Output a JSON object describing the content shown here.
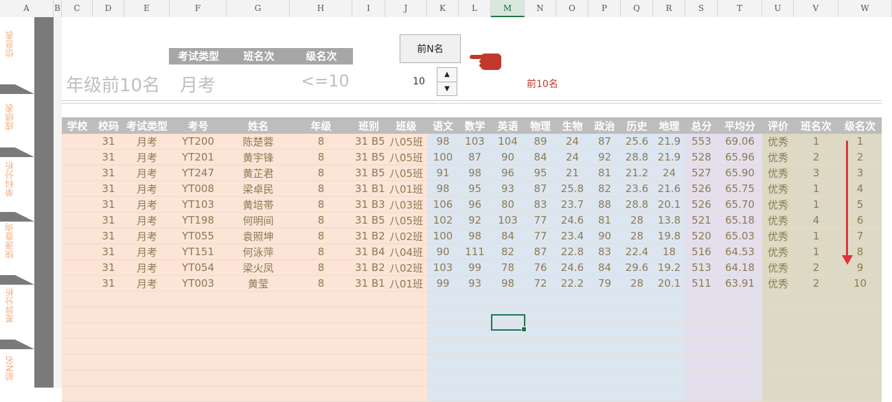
{
  "columns": [
    "A",
    "B",
    "C",
    "D",
    "E",
    "F",
    "G",
    "H",
    "I",
    "J",
    "K",
    "L",
    "M",
    "N",
    "O",
    "P",
    "Q",
    "R",
    "S",
    "T",
    "U",
    "V",
    "W"
  ],
  "sheet_tabs": [
    "信息表",
    "成绩表",
    "单科分析",
    "快速查询",
    "差异分析",
    "前N名"
  ],
  "title": "年级前10名",
  "criteria": {
    "headers": [
      "考试类型",
      "班名次",
      "级名次"
    ],
    "exam_type": "月考",
    "grade_rank_filter": "<=10"
  },
  "button_label": "前N名",
  "spinner_value": "10",
  "result_note": "前10名",
  "colors": {
    "accent": "#217346",
    "arrow": "#e0333a",
    "hand": "#c0392b"
  },
  "icons": [
    "pointing-hand-icon",
    "spin-up-icon",
    "spin-down-icon",
    "down-arrow-icon"
  ],
  "table": {
    "headers": [
      "学校",
      "校码",
      "考试类型",
      "考号",
      "姓名",
      "年级",
      "班别",
      "班级",
      "语文",
      "数学",
      "英语",
      "物理",
      "生物",
      "政治",
      "历史",
      "地理",
      "总分",
      "平均分",
      "评价",
      "班名次",
      "级名次"
    ],
    "rows": [
      [
        "",
        "31",
        "月考",
        "YT200",
        "陈楚蓉",
        "8",
        "31 B5",
        "八05班",
        "98",
        "103",
        "104",
        "89",
        "24",
        "87",
        "25.6",
        "21.9",
        "553",
        "69.06",
        "优秀",
        "1",
        "1"
      ],
      [
        "",
        "31",
        "月考",
        "YT201",
        "黄宇锋",
        "8",
        "31 B5",
        "八05班",
        "100",
        "87",
        "90",
        "84",
        "24",
        "92",
        "28.8",
        "21.9",
        "528",
        "65.96",
        "优秀",
        "2",
        "2"
      ],
      [
        "",
        "31",
        "月考",
        "YT247",
        "黄芷君",
        "8",
        "31 B5",
        "八05班",
        "91",
        "98",
        "96",
        "95",
        "21",
        "81",
        "21.2",
        "24",
        "527",
        "65.90",
        "优秀",
        "3",
        "3"
      ],
      [
        "",
        "31",
        "月考",
        "YT008",
        "梁卓民",
        "8",
        "31 B1",
        "八01班",
        "98",
        "95",
        "93",
        "87",
        "25.8",
        "82",
        "23.6",
        "21.6",
        "526",
        "65.75",
        "优秀",
        "1",
        "4"
      ],
      [
        "",
        "31",
        "月考",
        "YT103",
        "黄培帯",
        "8",
        "31 B3",
        "八03班",
        "106",
        "96",
        "80",
        "83",
        "23.7",
        "88",
        "28.8",
        "20.1",
        "526",
        "65.70",
        "优秀",
        "1",
        "5"
      ],
      [
        "",
        "31",
        "月考",
        "YT198",
        "何明间",
        "8",
        "31 B5",
        "八05班",
        "102",
        "92",
        "103",
        "77",
        "24.6",
        "81",
        "28",
        "13.8",
        "521",
        "65.18",
        "优秀",
        "4",
        "6"
      ],
      [
        "",
        "31",
        "月考",
        "YT055",
        "袁照坤",
        "8",
        "31 B2",
        "八02班",
        "100",
        "98",
        "84",
        "77",
        "23.4",
        "90",
        "28",
        "19.8",
        "520",
        "65.03",
        "优秀",
        "1",
        "7"
      ],
      [
        "",
        "31",
        "月考",
        "YT151",
        "何泳萍",
        "8",
        "31 B4",
        "八04班",
        "90",
        "111",
        "82",
        "87",
        "22.8",
        "83",
        "22.4",
        "18",
        "516",
        "64.53",
        "优秀",
        "1",
        "8"
      ],
      [
        "",
        "31",
        "月考",
        "YT054",
        "梁火凤",
        "8",
        "31 B2",
        "八02班",
        "103",
        "99",
        "78",
        "76",
        "24.6",
        "84",
        "29.6",
        "19.2",
        "513",
        "64.18",
        "优秀",
        "2",
        "9"
      ],
      [
        "",
        "31",
        "月考",
        "YT003",
        "黄莹",
        "8",
        "31 B1",
        "八01班",
        "99",
        "93",
        "98",
        "72",
        "22.2",
        "79",
        "28",
        "20.1",
        "511",
        "63.91",
        "优秀",
        "2",
        "10"
      ]
    ]
  }
}
